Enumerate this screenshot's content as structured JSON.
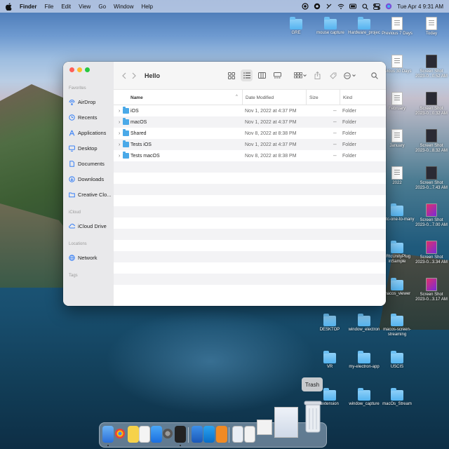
{
  "menubar": {
    "app": "Finder",
    "menus": [
      "File",
      "Edit",
      "View",
      "Go",
      "Window",
      "Help"
    ],
    "clock": "Tue Apr 4  9:31 AM"
  },
  "desktop_icons": [
    {
      "label": "GRE",
      "kind": "folder"
    },
    {
      "label": "mouse capture",
      "kind": "folder"
    },
    {
      "label": "Hardware_projec",
      "kind": "folder"
    },
    {
      "label": "Previous 7 Days",
      "kind": "doc"
    },
    {
      "label": "Today",
      "kind": "doc"
    },
    {
      "label": "evious 30 Days",
      "kind": "doc"
    },
    {
      "label": "Screen Shot 2023-0...0.52 AM",
      "kind": "doc"
    },
    {
      "label": "February",
      "kind": "doc"
    },
    {
      "label": "Screen Shot 2023-0...0.32 AM",
      "kind": "doc"
    },
    {
      "label": "January",
      "kind": "doc"
    },
    {
      "label": "Screen Shot 2023-0...8.32 AM",
      "kind": "doc"
    },
    {
      "label": "2022",
      "kind": "doc"
    },
    {
      "label": "Screen Shot 2023-0...7.43 AM",
      "kind": "doc"
    },
    {
      "label": "ebrtc-one-to-many",
      "kind": "folder"
    },
    {
      "label": "Screen Shot 2023-0...7.00 AM",
      "kind": "doc"
    },
    {
      "label": "bRtcUnityPlug inSample",
      "kind": "folder"
    },
    {
      "label": "Screen Shot 2023-0...3.34 AM",
      "kind": "doc"
    },
    {
      "label": "macos_viewer",
      "kind": "folder"
    },
    {
      "label": "Screen Shot 2023-0...3.17 AM",
      "kind": "doc"
    },
    {
      "label": "DESKTOP",
      "kind": "folder"
    },
    {
      "label": "window_electron",
      "kind": "folder"
    },
    {
      "label": "macos-screen-streaming",
      "kind": "folder"
    },
    {
      "label": "VR",
      "kind": "folder"
    },
    {
      "label": "my-electron-app",
      "kind": "folder"
    },
    {
      "label": "USCIS",
      "kind": "folder"
    },
    {
      "label": "extension",
      "kind": "folder"
    },
    {
      "label": "window_capture",
      "kind": "folder"
    },
    {
      "label": "macOs_Stream",
      "kind": "folder"
    }
  ],
  "finder": {
    "title": "Hello",
    "sidebar": {
      "favorites_header": "Favorites",
      "favorites": [
        {
          "label": "AirDrop",
          "icon": "airdrop-icon"
        },
        {
          "label": "Recents",
          "icon": "clock-icon"
        },
        {
          "label": "Applications",
          "icon": "applications-icon"
        },
        {
          "label": "Desktop",
          "icon": "desktop-icon"
        },
        {
          "label": "Documents",
          "icon": "document-icon"
        },
        {
          "label": "Downloads",
          "icon": "download-icon"
        },
        {
          "label": "Creative Clo...",
          "icon": "folder-icon"
        }
      ],
      "icloud_header": "iCloud",
      "icloud": [
        {
          "label": "iCloud Drive",
          "icon": "cloud-icon"
        }
      ],
      "locations_header": "Locations",
      "locations": [
        {
          "label": "Network",
          "icon": "globe-icon"
        }
      ],
      "tags_header": "Tags"
    },
    "columns": {
      "name": "Name",
      "date": "Date Modified",
      "size": "Size",
      "kind": "Kind"
    },
    "files": [
      {
        "name": "iOS",
        "date": "Nov 1, 2022 at 4:37 PM",
        "size": "--",
        "kind": "Folder"
      },
      {
        "name": "macOS",
        "date": "Nov 1, 2022 at 4:37 PM",
        "size": "--",
        "kind": "Folder"
      },
      {
        "name": "Shared",
        "date": "Nov 8, 2022 at 8:38 PM",
        "size": "--",
        "kind": "Folder"
      },
      {
        "name": "Tests iOS",
        "date": "Nov 1, 2022 at 4:37 PM",
        "size": "--",
        "kind": "Folder"
      },
      {
        "name": "Tests macOS",
        "date": "Nov 8, 2022 at 8:38 PM",
        "size": "--",
        "kind": "Folder"
      }
    ]
  },
  "dock": {
    "tooltip": "Trash"
  }
}
